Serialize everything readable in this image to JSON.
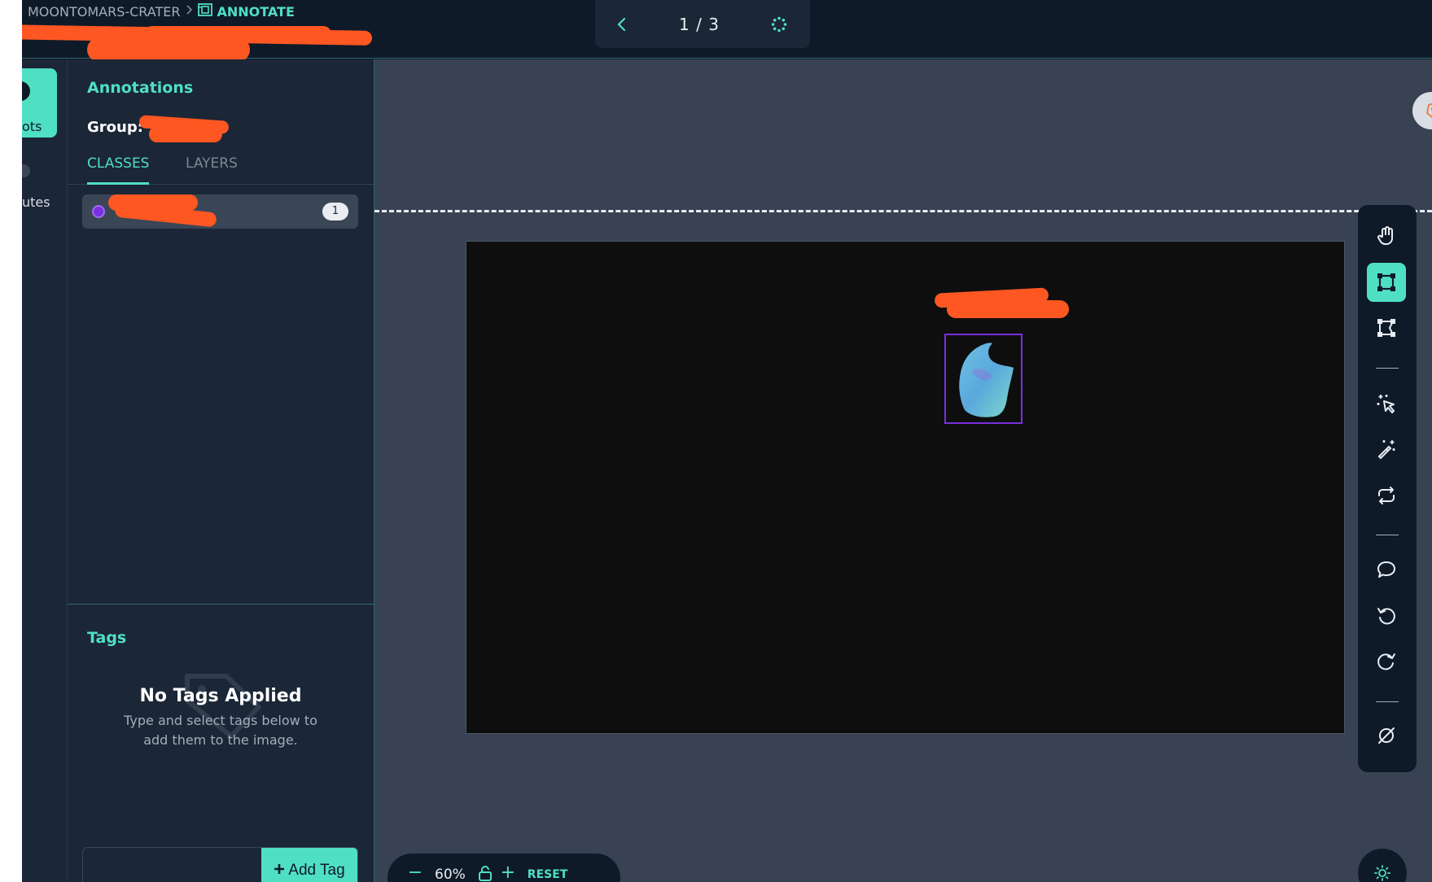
{
  "breadcrumb": {
    "project": "MOONTOMARS-CRATER",
    "current": "ANNOTATE"
  },
  "pager": {
    "position": "1 / 3"
  },
  "rail": {
    "item1_label": "ots",
    "item2_label": "utes"
  },
  "panel": {
    "title": "Annotations",
    "group_label": "Group:",
    "tabs": [
      "CLASSES",
      "LAYERS"
    ],
    "classes": [
      {
        "count": "1"
      }
    ],
    "tags": {
      "title": "Tags",
      "empty_heading": "No Tags Applied",
      "empty_line1": "Type and select tags below to",
      "empty_line2": "add them to the image.",
      "add_button": "Add Tag"
    }
  },
  "zoom": {
    "value": "60%",
    "reset_label": "RESET"
  },
  "colors": {
    "accent": "#4fe0c3",
    "class_color": "#7a2fe0",
    "redaction": "#ff5722"
  },
  "toolbar": {
    "tools": [
      "hand-icon",
      "bounding-box-icon",
      "polygon-icon",
      "smart-select-icon",
      "magic-wand-icon",
      "repeat-icon",
      "comment-icon",
      "undo-icon",
      "redo-icon",
      "hide-icon"
    ],
    "active_tool": "bounding-box-icon"
  }
}
